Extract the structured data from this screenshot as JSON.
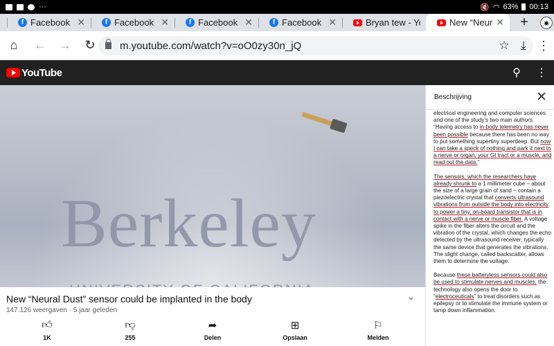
{
  "status_bar": {
    "battery": "63%",
    "time": "00:13",
    "dots": "···"
  },
  "tabs": [
    {
      "title": "Facebook",
      "icon": "facebook-icon",
      "active": false,
      "close": "✕"
    },
    {
      "title": "Facebook",
      "icon": "facebook-icon",
      "active": false,
      "close": "✕"
    },
    {
      "title": "Facebook",
      "icon": "facebook-icon",
      "active": false,
      "close": "✕"
    },
    {
      "title": "Facebook",
      "icon": "facebook-icon",
      "active": false,
      "close": "✕"
    },
    {
      "title": "Bryan tew - Yo",
      "icon": "youtube-icon",
      "active": false,
      "close": ""
    },
    {
      "title": "New “Neural D",
      "icon": "youtube-icon",
      "active": true,
      "close": "✕"
    }
  ],
  "new_tab": "+",
  "address_bar": {
    "url": "m.youtube.com/watch?v=oO0zy30n_jQ"
  },
  "youtube": {
    "logo_text": "YouTube"
  },
  "video": {
    "overlay_big": "Berkeley",
    "overlay_small": "UNIVERSITY OF CALIFORNIA",
    "title": "New “Neural Dust” sensor could be implanted in the body",
    "meta": "147.126 weergaven · 5 jaar geleden"
  },
  "actions": [
    {
      "name": "like",
      "icon": "thumbs-up-icon",
      "label": "1K"
    },
    {
      "name": "dislike",
      "icon": "thumbs-down-icon",
      "label": "255"
    },
    {
      "name": "share",
      "icon": "share-icon",
      "label": "Delen"
    },
    {
      "name": "save",
      "icon": "add-to-playlist-icon",
      "label": "Opslaan"
    },
    {
      "name": "report",
      "icon": "flag-icon",
      "label": "Melden"
    }
  ],
  "description": {
    "heading": "Beschrijving",
    "p1_a": "electrical engineering and computer sciences and one of the study’s two main authors. “Having access to ",
    "p1_u1": "in-body telemetry has never been possible",
    "p1_b": " because there has been no way to put something supertiny superdeep. But ",
    "p1_u2": "now I can take a speck of nothing and park it next to a nerve or organ, your GI tract or a muscle, and read out the data.",
    "p1_c": "”",
    "p2_u1": "The sensors, which the researchers have already shrunk to",
    "p2_a": " a 1 millimeter cube – about the size of a large grain of sand – contain a piezoelectric crystal that ",
    "p2_u2": "converts ultrasound vibrations from outside the body into electricity to power a tiny, on-board transistor that is in contact with a nerve or muscle fiber.",
    "p2_b": " A voltage spike in the fiber alters the circuit and the vibration of the crystal, which changes the echo detected by the ultrasound receiver, typically the same device that generates the vibrations. The slight change, called backscatter, allows them to determine the voltage.",
    "p3_a": "Because ",
    "p3_u1": "these batteryless sensors could also be used to stimulate nerves and muscles,",
    "p3_b": " the technology also opens the door to “",
    "p3_u2": "electroceuticals",
    "p3_c": "” to treat disorders such as epilepsy or to stimulate the immune system or tamp down inflammation."
  }
}
